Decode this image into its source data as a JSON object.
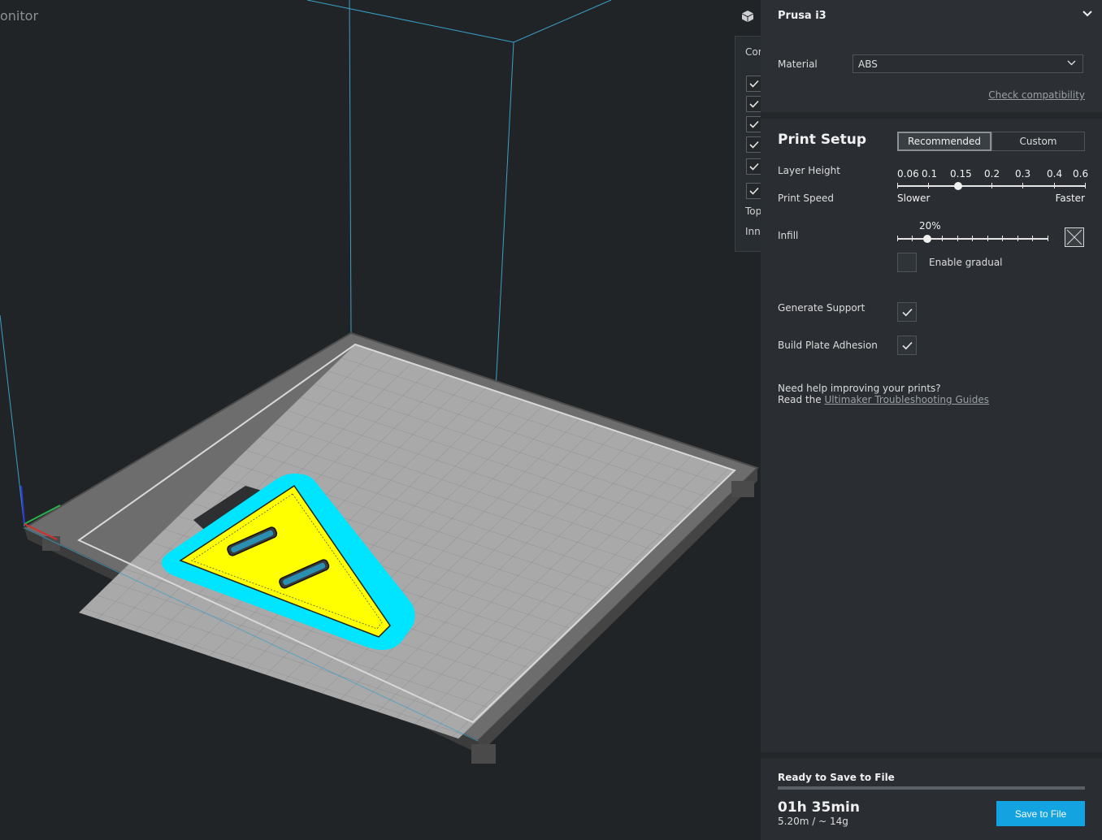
{
  "viewport": {
    "stage_label": "onitor",
    "layer_panel": {
      "title": "Cor",
      "checked_rows": 6,
      "text_rows": [
        "Top",
        "Inn"
      ]
    }
  },
  "sidebar": {
    "printer": {
      "name": "Prusa i3",
      "material_label": "Material",
      "material_value": "ABS",
      "check_compatibility": "Check compatibility"
    },
    "print_setup": {
      "title": "Print Setup",
      "tabs": [
        {
          "label": "Recommended",
          "active": true
        },
        {
          "label": "Custom",
          "active": false
        }
      ],
      "layer_height": {
        "label": "Layer Height",
        "ticks": [
          "0.06",
          "0.1",
          "0.15",
          "0.2",
          "0.3",
          "0.4",
          "0.6"
        ],
        "selected": "0.15"
      },
      "print_speed": {
        "label": "Print Speed",
        "slower": "Slower",
        "faster": "Faster"
      },
      "infill": {
        "label": "Infill",
        "value": "20%",
        "percent": 20,
        "enable_gradual_label": "Enable gradual",
        "enable_gradual": false
      },
      "generate_support": {
        "label": "Generate Support",
        "checked": true
      },
      "build_plate_adhesion": {
        "label": "Build Plate Adhesion",
        "checked": true
      },
      "help": {
        "line1": "Need help improving your prints?",
        "line2_prefix": "Read the ",
        "link": "Ultimaker Troubleshooting Guides"
      }
    },
    "job": {
      "status": "Ready to Save to File",
      "progress": 1.0,
      "time": "01h 35min",
      "material": "5.20m / ~ 14g",
      "save_label": "Save to File"
    }
  },
  "colors": {
    "accent": "#12a3e0",
    "model": "#ffff00",
    "brim": "#00e5ff",
    "plate": "#a8a8a8",
    "build_volume": "#3aa0c8"
  }
}
